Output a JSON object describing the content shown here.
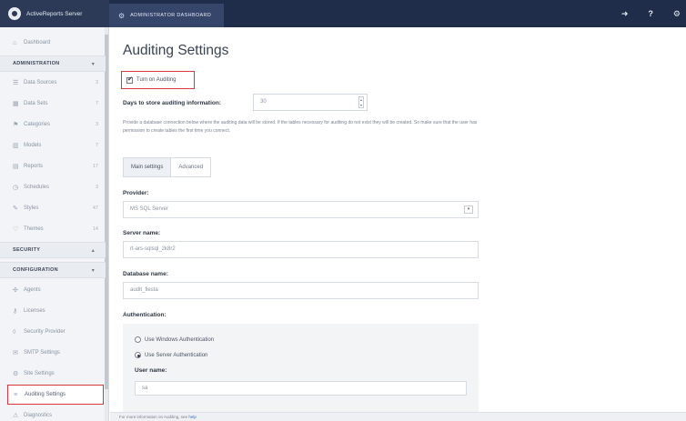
{
  "topbar": {
    "brand": "ActiveReports Server",
    "admin_tab": "ADMINISTRATOR DASHBOARD",
    "icons": [
      "sign-out-icon",
      "help-icon",
      "settings-icon"
    ],
    "help_glyph": "?"
  },
  "sidebar": {
    "dashboard": "Dashboard",
    "administration": "ADMINISTRATION",
    "admin_items": [
      {
        "label": "Data Sources",
        "count": "3"
      },
      {
        "label": "Data Sets",
        "count": "7"
      },
      {
        "label": "Categories",
        "count": "3"
      },
      {
        "label": "Models",
        "count": "7"
      },
      {
        "label": "Reports",
        "count": "17"
      },
      {
        "label": "Schedules",
        "count": "3"
      },
      {
        "label": "Styles",
        "count": "47"
      },
      {
        "label": "Themes",
        "count": "14"
      }
    ],
    "security": "SECURITY",
    "configuration": "CONFIGURATION",
    "config_items": [
      {
        "label": "Agents"
      },
      {
        "label": "Licenses"
      },
      {
        "label": "Security Provider"
      },
      {
        "label": "SMTP Settings"
      },
      {
        "label": "Site Settings"
      },
      {
        "label": "Auditing Settings"
      },
      {
        "label": "Diagnostics"
      }
    ]
  },
  "main": {
    "title": "Auditing Settings",
    "turn_on_auditing": "Turn on Auditing",
    "turn_on_checked": true,
    "days_label": "Days to store auditing information:",
    "days_value": "30",
    "description": "Provide a database connection below where the auditing data will be stored. If the tables necessary for auditing do not exist they will be created. So make sure that the user has permission to create tables the first time you connect.",
    "tabs": [
      "Main settings",
      "Advanced"
    ],
    "provider_label": "Provider:",
    "provider_value": "MS SQL Server",
    "server_label": "Server name:",
    "server_value": "rt-ars-sqlsql_2k8r2",
    "database_label": "Database name:",
    "database_value": "audit_fiesta",
    "auth_label": "Authentication:",
    "auth_options": [
      "Use Windows Authentication",
      "Use Server Authentication"
    ],
    "auth_selected": "Use Server Authentication",
    "user_label": "User name:",
    "user_value": "sa",
    "footer_text": "For more information on Auditing, see",
    "footer_link": "help"
  }
}
